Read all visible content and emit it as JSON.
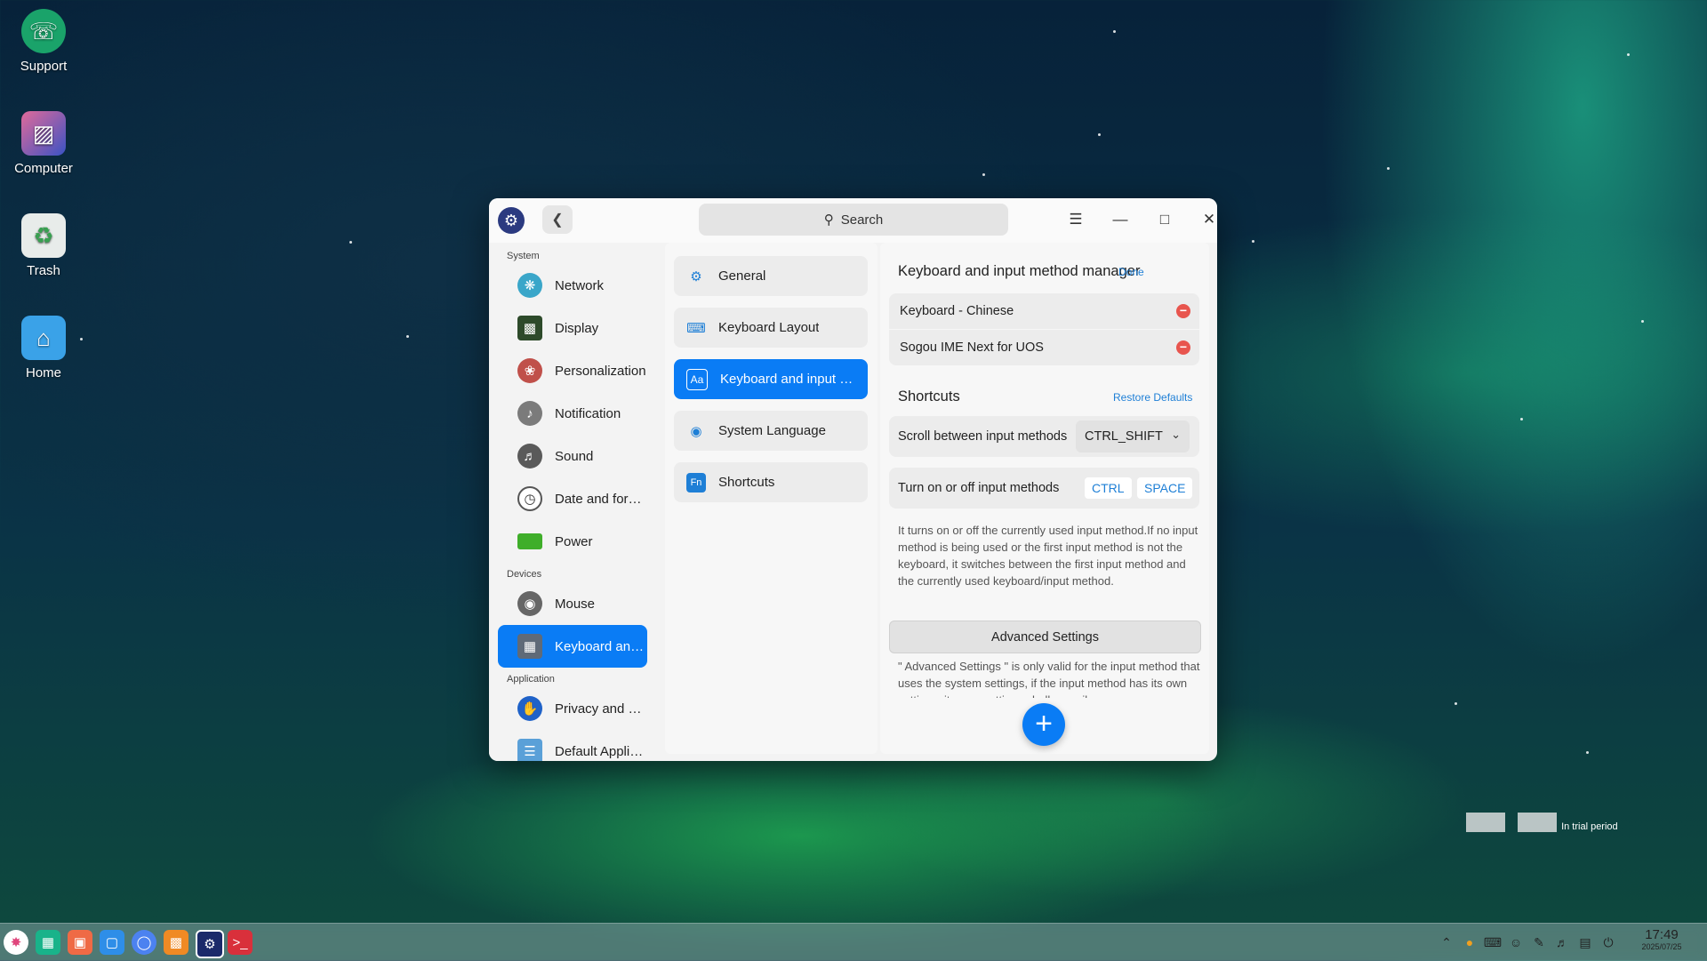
{
  "desktop": {
    "icons": [
      {
        "label": "Support",
        "icon": "headset-icon"
      },
      {
        "label": "Computer",
        "icon": "monitor-icon"
      },
      {
        "label": "Trash",
        "icon": "trash-icon"
      },
      {
        "label": "Home",
        "icon": "home-folder-icon"
      }
    ],
    "watermark": "In trial period"
  },
  "window": {
    "search_placeholder": "Search",
    "sidebar": {
      "sections": {
        "system": "System",
        "devices": "Devices",
        "application": "Application"
      },
      "items": [
        {
          "label": "Network",
          "icon": "network-icon",
          "color": "#3aa6c9"
        },
        {
          "label": "Display",
          "icon": "display-icon",
          "color": "#2d4a2a"
        },
        {
          "label": "Personalization",
          "icon": "palette-icon",
          "color": "#c0504a"
        },
        {
          "label": "Notification",
          "icon": "bell-icon",
          "color": "#7b7b7b"
        },
        {
          "label": "Sound",
          "icon": "speaker-icon",
          "color": "#5a5a5a"
        },
        {
          "label": "Date and for…",
          "icon": "clock-icon",
          "color": "#ffffff"
        },
        {
          "label": "Power",
          "icon": "battery-icon",
          "color": "#3fae2a"
        },
        {
          "label": "Mouse",
          "icon": "mouse-icon",
          "color": "#666666"
        },
        {
          "label": "Keyboard an…",
          "icon": "keyboard-icon",
          "color": "#5f6a78"
        },
        {
          "label": "Privacy and S…",
          "icon": "shield-icon",
          "color": "#1f62c8"
        },
        {
          "label": "Default Appli…",
          "icon": "default-apps-icon",
          "color": "#5aa0d8"
        }
      ]
    },
    "subnav": [
      {
        "label": "General",
        "icon": "gear-icon"
      },
      {
        "label": "Keyboard Layout",
        "icon": "keyboard-layout-icon"
      },
      {
        "label": "Keyboard and input m…",
        "icon": "input-method-icon"
      },
      {
        "label": "System Language",
        "icon": "globe-icon"
      },
      {
        "label": "Shortcuts",
        "icon": "fn-key-icon"
      }
    ],
    "content": {
      "title": "Keyboard and input method manager",
      "done": "Done",
      "input_methods": [
        "Keyboard - Chinese",
        "Sogou IME Next for UOS"
      ],
      "shortcuts_title": "Shortcuts",
      "restore": "Restore Defaults",
      "scroll_label": "Scroll between input methods",
      "scroll_value": "CTRL_SHIFT",
      "toggle_label": "Turn on or off input methods",
      "toggle_keys": [
        "CTRL",
        "SPACE"
      ],
      "description": "It turns on or off the currently used input method.If no input method is being used or the first input method is not the keyboard, it switches between the first input method and the currently used keyboard/input method.",
      "advanced_button": "Advanced Settings",
      "advanced_desc": "\" Advanced Settings \" is only valid for the input method that uses the system settings, if the input method has its own settings, its own settings shall prevail."
    }
  },
  "taskbar": {
    "apps": [
      "launcher-icon",
      "multitask-icon",
      "app-store-icon",
      "file-manager-icon",
      "browser-icon",
      "office-icon",
      "control-center-icon",
      "terminal-icon"
    ],
    "time": "17:49",
    "date": "2025/07/25"
  },
  "colors": {
    "accent": "#0a7cf5",
    "remove": "#e8554e",
    "link": "#1e7fd6"
  }
}
